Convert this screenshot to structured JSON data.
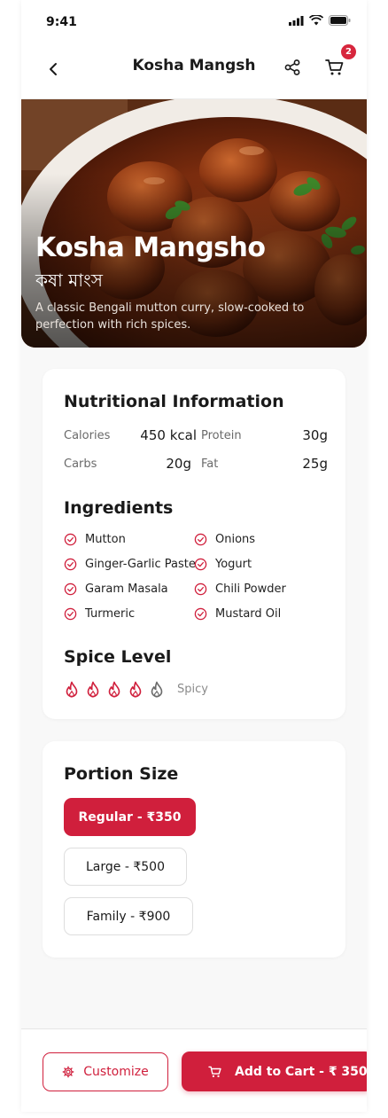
{
  "status": {
    "time": "9:41"
  },
  "header": {
    "title": "Kosha Mangsh",
    "cart_count": "2"
  },
  "hero": {
    "title": "Kosha Mangsho",
    "subtitle": "কষা মাংস",
    "description": "A classic Bengali mutton curry, slow-cooked to perfection with rich spices."
  },
  "nutrition": {
    "heading": "Nutritional Information",
    "items": [
      {
        "label": "Calories",
        "value": "450 kcal"
      },
      {
        "label": "Protein",
        "value": "30g"
      },
      {
        "label": "Carbs",
        "value": "20g"
      },
      {
        "label": "Fat",
        "value": "25g"
      }
    ]
  },
  "ingredients": {
    "heading": "Ingredients",
    "items": [
      "Mutton",
      "Onions",
      "Ginger-Garlic Paste",
      "Yogurt",
      "Garam Masala",
      "Chili Powder",
      "Turmeric",
      "Mustard Oil"
    ]
  },
  "spice": {
    "heading": "Spice Level",
    "level": 4,
    "max": 5,
    "label": "Spicy"
  },
  "portion": {
    "heading": "Portion Size",
    "options": [
      "Regular - ₹350",
      "Large - ₹500",
      "Family - ₹900"
    ],
    "selected_index": 0
  },
  "footer": {
    "customize_label": "Customize",
    "add_to_cart_label": "Add to Cart - ₹ 350"
  },
  "colors": {
    "accent": "#d01f3c",
    "badge": "#d7263d",
    "inactive_flame": "#6b6b6b"
  }
}
